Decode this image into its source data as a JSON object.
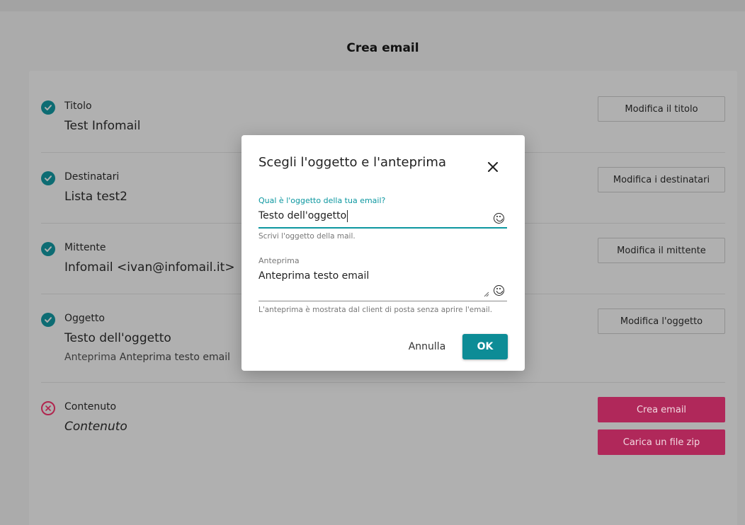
{
  "page": {
    "title": "Crea email"
  },
  "rows": [
    {
      "status": "done",
      "label": "Titolo",
      "value": "Test Infomail",
      "button": "Modifica il titolo"
    },
    {
      "status": "done",
      "label": "Destinatari",
      "value": "Lista test2",
      "button": "Modifica i destinatari"
    },
    {
      "status": "done",
      "label": "Mittente",
      "value": "Infomail <ivan@infomail.it>",
      "button": "Modifica il mittente"
    },
    {
      "status": "done",
      "label": "Oggetto",
      "value": "Testo dell'oggetto",
      "sub_label": "Anteprima",
      "sub_value": "Anteprima testo email",
      "button": "Modifica l'oggetto"
    },
    {
      "status": "missing",
      "label": "Contenuto",
      "value": "Contenuto",
      "button": "Crea email",
      "button2": "Carica un file zip"
    }
  ],
  "modal": {
    "title": "Scegli l'oggetto e l'anteprima",
    "subject": {
      "label": "Qual è l'oggetto della tua email?",
      "value": "Testo dell'oggetto",
      "helper": "Scrivi l'oggetto della mail."
    },
    "preview": {
      "label": "Anteprima",
      "value": "Anteprima testo email",
      "helper": "L'anteprima è mostrata dal client di posta senza aprire l'email."
    },
    "cancel_label": "Annulla",
    "ok_label": "OK"
  },
  "colors": {
    "accent": "#0c97a0",
    "check": "#0d6c73",
    "pink": "#b0285a",
    "overlay": "#ababab"
  }
}
